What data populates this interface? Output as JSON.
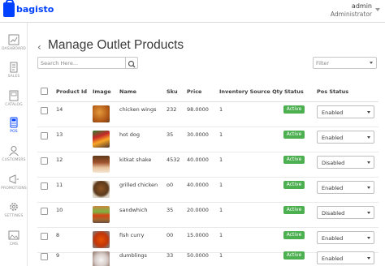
{
  "header": {
    "brand": "bagisto",
    "user_name": "admin",
    "user_role": "Administrator"
  },
  "sidebar": {
    "items": [
      {
        "label": "DASHBOARD",
        "icon": "dashboard-icon",
        "active": false
      },
      {
        "label": "SALES",
        "icon": "sales-icon",
        "active": false
      },
      {
        "label": "CATALOG",
        "icon": "catalog-icon",
        "active": false
      },
      {
        "label": "POS",
        "icon": "pos-icon",
        "active": true
      },
      {
        "label": "CUSTOMERS",
        "icon": "customers-icon",
        "active": false
      },
      {
        "label": "PROMOTIONS",
        "icon": "promotions-icon",
        "active": false
      },
      {
        "label": "SETTINGS",
        "icon": "settings-icon",
        "active": false
      },
      {
        "label": "CMS",
        "icon": "cms-icon",
        "active": false
      }
    ]
  },
  "page": {
    "title": "Manage Outlet Products",
    "search_placeholder": "Search Here...",
    "filter_label": "Filter"
  },
  "table": {
    "headers": {
      "product_id": "Product Id",
      "image": "Image",
      "name": "Name",
      "sku": "Sku",
      "price": "Price",
      "qty": "Inventory Source Qty",
      "status": "Status",
      "pos_status": "Pos Status"
    },
    "rows": [
      {
        "id": "14",
        "name": "chicken wings",
        "sku": "232",
        "price": "98.0000",
        "qty": "1",
        "status": "Active",
        "pos_status": "Enabled",
        "image": "chicken-wings-image"
      },
      {
        "id": "13",
        "name": "hot dog",
        "sku": "35",
        "price": "30.0000",
        "qty": "1",
        "status": "Active",
        "pos_status": "Enabled",
        "image": "hot-dog-image"
      },
      {
        "id": "12",
        "name": "kitkat shake",
        "sku": "4532",
        "price": "40.0000",
        "qty": "1",
        "status": "Active",
        "pos_status": "Disabled",
        "image": "kitkat-shake-image"
      },
      {
        "id": "11",
        "name": "grilled chicken",
        "sku": "o0",
        "price": "40.0000",
        "qty": "1",
        "status": "Active",
        "pos_status": "Enabled",
        "image": "grilled-chicken-image"
      },
      {
        "id": "10",
        "name": "sandwhich",
        "sku": "35",
        "price": "20.0000",
        "qty": "1",
        "status": "Active",
        "pos_status": "Disabled",
        "image": "sandwich-image"
      },
      {
        "id": "8",
        "name": "fish curry",
        "sku": "00",
        "price": "15.0000",
        "qty": "1",
        "status": "Active",
        "pos_status": "Enabled",
        "image": "fish-curry-image"
      },
      {
        "id": "9",
        "name": "dumblings",
        "sku": "33",
        "price": "50.0000",
        "qty": "1",
        "status": "Active",
        "pos_status": "Enabled",
        "image": "dumplings-image"
      }
    ]
  },
  "colors": {
    "brand": "#0041ff",
    "active_badge": "#4caf50",
    "pos_active": "#0041ff"
  }
}
